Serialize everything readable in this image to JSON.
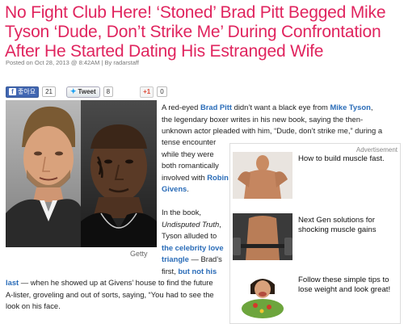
{
  "article": {
    "headline": "No Fight Club Here! ‘Stoned’ Brad Pitt Begged Mike Tyson ‘Dude, Don’t Strike Me’ During Confrontation After He Started Dating His Estranged Wife",
    "meta": "Posted on Oct 28, 2013 @ 8:42AM | By radarstaff",
    "photo_credit": "Getty",
    "p1": {
      "a": "A red-eyed ",
      "brad": "Brad Pitt",
      "b": " didn’t want a black eye from ",
      "tyson": "Mike Tyson",
      "c": ",",
      "line2": "the legendary boxer writes in his new book, saying the then-",
      "line3": "unknown actor pleaded with him, “Dude, don’t strike me,” during a",
      "line4": "tense encounter",
      "line5": "while they were",
      "line6": "both romantically",
      "line7a": "involved with ",
      "robin1": "Robin",
      "robin2": "Givens",
      "end": "."
    },
    "p2": {
      "l1": "In the book,",
      "book": "Undisputed Truth",
      "l2end": ",",
      "l3": "Tyson alluded to",
      "l4link": "the celebrity love",
      "l5link": "triangle",
      "l5end": " — Brad’s",
      "l6a": "first, ",
      "l6link": "but not his",
      "l7link": "last",
      "l7end": " — when he showed up at Givens’ house to find the future",
      "l8": "A-lister, groveling and out of sorts, saying, “You had to see the",
      "l9": "look on his face."
    }
  },
  "share": {
    "fb_label": "좋아요",
    "fb_count": "21",
    "tweet_label": "Tweet",
    "tweet_count": "8",
    "gplus_label": "+1",
    "gplus_count": "0"
  },
  "ad": {
    "label": "Advertisement",
    "items": [
      {
        "text": "How to build muscle fast."
      },
      {
        "text": "Next Gen solutions for shocking muscle gains"
      },
      {
        "text": "Follow these simple tips to lose weight and look great!"
      }
    ]
  },
  "colors": {
    "headline": "#e0245e",
    "link": "#2a6cb8"
  }
}
